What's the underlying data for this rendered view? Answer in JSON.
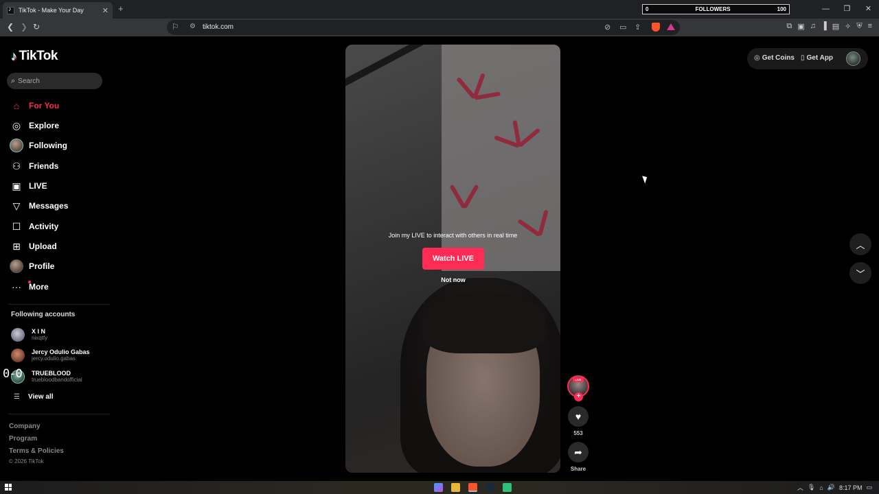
{
  "browser": {
    "tab_title": "TikTok - Make Your Day",
    "url": "tiktok.com",
    "tab_close": "✕",
    "new_tab": "+",
    "followers_widget": {
      "left": "0",
      "label": "FOLLOWERS",
      "right": "100",
      "progress_fraction": 0
    },
    "window_controls": [
      "—",
      "❐",
      "✕"
    ]
  },
  "sidebar": {
    "brand": "TikTok",
    "search_placeholder": "Search",
    "menu": [
      {
        "label": "For You",
        "icon": "home-icon",
        "active": true
      },
      {
        "label": "Explore",
        "icon": "compass-icon"
      },
      {
        "label": "Following",
        "icon": "avatar"
      },
      {
        "label": "Friends",
        "icon": "friends-icon"
      },
      {
        "label": "LIVE",
        "icon": "live-tv-icon"
      },
      {
        "label": "Messages",
        "icon": "send-icon"
      },
      {
        "label": "Activity",
        "icon": "activity-icon"
      },
      {
        "label": "Upload",
        "icon": "plus-square-icon"
      },
      {
        "label": "Profile",
        "icon": "avatar"
      },
      {
        "label": "More",
        "icon": "more-dots-icon"
      }
    ],
    "following_heading": "Following accounts",
    "accounts": [
      {
        "name": "X I N",
        "username": "nixqtfy"
      },
      {
        "name": "Jercy Odulio Gabas",
        "username": "jercy.odulio.gabas"
      },
      {
        "name": "TRUEBLOOD",
        "username": "truebloodbandofficial"
      }
    ],
    "view_all": "View all",
    "footer": [
      "Company",
      "Program",
      "Terms & Policies"
    ],
    "copyright": "© 2026 TikTok"
  },
  "overlay_counter": "0-0",
  "video": {
    "live_prompt": "Join my LIVE to interact with others in real time",
    "watch_live": "Watch LIVE",
    "not_now": "Not now"
  },
  "actions": {
    "live_badge": "LIVE",
    "follow_plus": "+",
    "likes": "553",
    "share": "Share"
  },
  "top_right": {
    "get_coins": "Get Coins",
    "get_app": "Get App"
  },
  "taskbar": {
    "time": "8:17 PM"
  },
  "colors": {
    "accent": "#fe2c55",
    "background": "#000000",
    "chrome": "#35363a"
  }
}
